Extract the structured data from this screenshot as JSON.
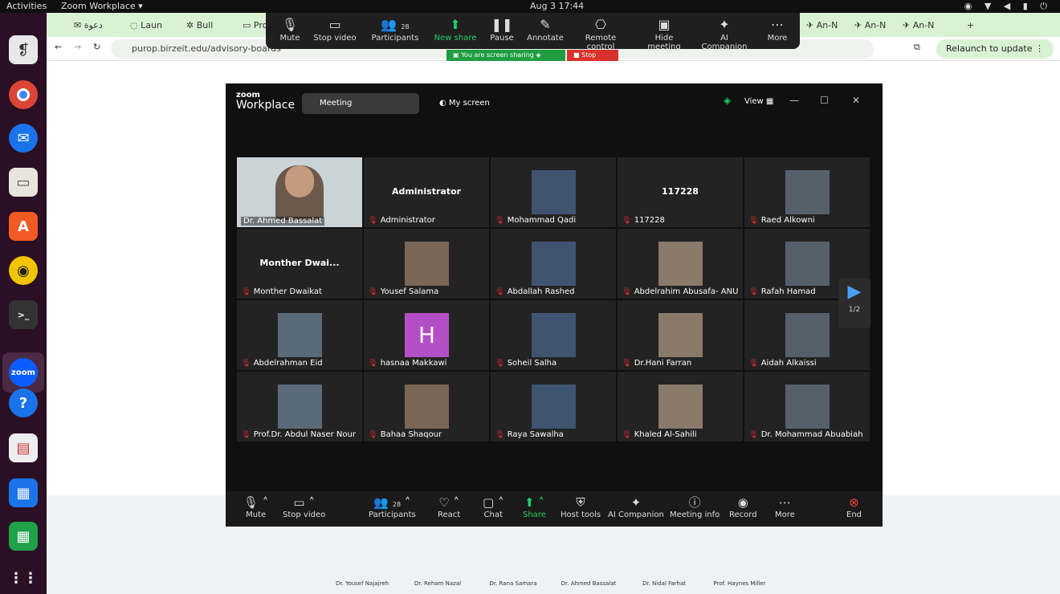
{
  "system": {
    "activities": "Activities",
    "app_menu": "Zoom Workplace ▾",
    "clock": "Aug 3  17:44"
  },
  "browser": {
    "tabs": [
      "دعوة",
      "Laun",
      "Bull",
      "Pro",
      "An-N",
      "An-N",
      "An-N"
    ],
    "url": "purop.birzeit.edu/advisory-boards",
    "relaunch": "Relaunch to update"
  },
  "zoom_top": {
    "mute": "Mute",
    "stop_video": "Stop video",
    "participants": "Participants",
    "participants_count": "28",
    "new_share": "New share",
    "pause": "Pause",
    "annotate": "Annotate",
    "remote_control": "Remote control",
    "hide_meeting": "Hide meeting",
    "ai_companion": "AI Companion",
    "more": "More",
    "sharing_notice": "You are screen sharing",
    "stop_share": "Stop share"
  },
  "zoom_window": {
    "brand_zoom": "zoom",
    "brand_workplace": "Workplace",
    "meeting_tab": "Meeting",
    "my_screen": "My screen",
    "view": "View",
    "page_indicator": "1/2"
  },
  "participants": [
    {
      "name": "Dr. Ahmed Bassalat",
      "kind": "video"
    },
    {
      "name": "Administrator",
      "kind": "text",
      "display": "Administrator"
    },
    {
      "name": "Mohammad Qadi",
      "kind": "photo"
    },
    {
      "name": "117228",
      "kind": "text",
      "display": "117228"
    },
    {
      "name": "Raed Alkowni",
      "kind": "photo"
    },
    {
      "name": "Monther Dwaikat",
      "kind": "text",
      "display": "Monther Dwai..."
    },
    {
      "name": "Yousef Salama",
      "kind": "photo"
    },
    {
      "name": "Abdallah Rashed",
      "kind": "photo"
    },
    {
      "name": "Abdelrahim Abusafa- ANU",
      "kind": "photo"
    },
    {
      "name": "Rafah Hamad",
      "kind": "photo"
    },
    {
      "name": "Abdelrahman Eid",
      "kind": "photo"
    },
    {
      "name": "hasnaa Makkawi",
      "kind": "avatar",
      "display": "H"
    },
    {
      "name": "Soheil Salha",
      "kind": "photo"
    },
    {
      "name": "Dr.Hani Farran",
      "kind": "photo"
    },
    {
      "name": "Aidah Alkaissi",
      "kind": "photo"
    },
    {
      "name": "Prof.Dr. Abdul Naser Nour",
      "kind": "photo"
    },
    {
      "name": "Bahaa Shaqour",
      "kind": "photo"
    },
    {
      "name": "Raya Sawalha",
      "kind": "photo"
    },
    {
      "name": "Khaled Al-Sahili",
      "kind": "photo"
    },
    {
      "name": "Dr. Mohammad Abuabiah",
      "kind": "photo"
    }
  ],
  "zoom_controls": {
    "mute": "Mute",
    "stop_video": "Stop video",
    "participants": "Participants",
    "participants_count": "28",
    "react": "React",
    "chat": "Chat",
    "share": "Share",
    "host_tools": "Host tools",
    "ai_companion": "AI Companion",
    "meeting_info": "Meeting info",
    "record": "Record",
    "more": "More",
    "end": "End"
  },
  "page_people": [
    "Dr. Yousef Najajreh",
    "Dr. Reham Nazal",
    "Dr. Rana Samara",
    "Dr. Ahmed Bassalat",
    "Dr. Nidal Farhat",
    "Prof. Haynes Miller"
  ],
  "colors": {
    "accent_green": "#1fd06a",
    "mute_red": "#e02828",
    "end_red": "#e8403a",
    "zoom_blue": "#0b5cff"
  }
}
